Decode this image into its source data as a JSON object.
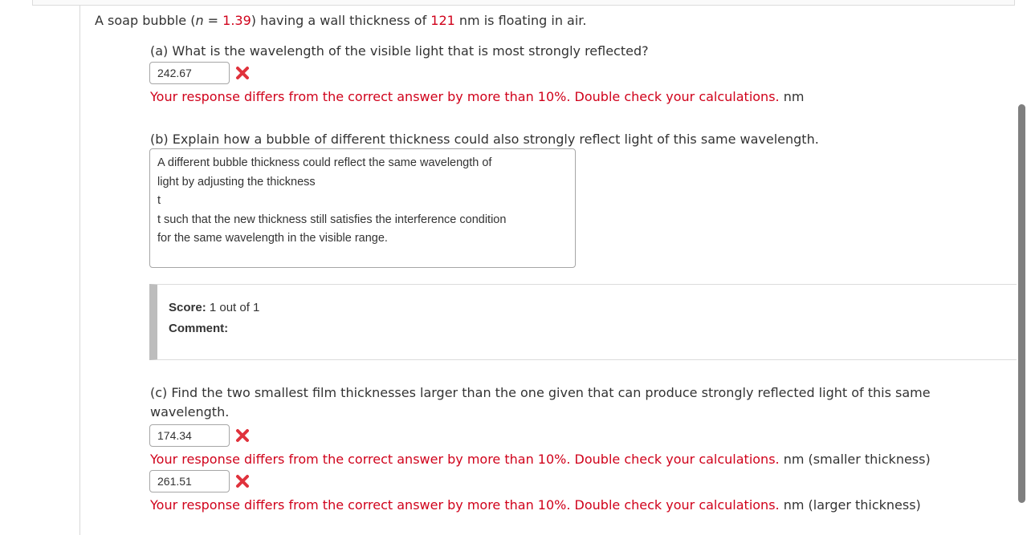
{
  "question": {
    "prefix": "A soap bubble (",
    "n_var": "n",
    "equals": " = ",
    "n_value": "1.39",
    "mid": ") having a wall thickness of ",
    "thickness": "121",
    "suffix": " nm is floating in air."
  },
  "part_a": {
    "prompt": "(a) What is the wavelength of the visible light that is most strongly reflected?",
    "answer": "242.67",
    "feedback": "Your response differs from the correct answer by more than 10%. Double check your calculations.",
    "unit": " nm"
  },
  "part_b": {
    "prompt": "(b) Explain how a bubble of different thickness could also strongly reflect light of this same wavelength.",
    "response_lines": [
      "A different bubble thickness could reflect the same wavelength of",
      "light by adjusting the thickness",
      "t",
      "t such that the new thickness still satisfies the interference condition",
      "for the same wavelength in the visible range."
    ]
  },
  "score": {
    "label": "Score:",
    "value": " 1 out of 1",
    "comment_label": "Comment:"
  },
  "part_c": {
    "prompt_line1": "(c) Find the two smallest film thicknesses larger than the one given that can produce strongly reflected light of this same",
    "prompt_line2": "wavelength.",
    "answer1": "174.34",
    "feedback1": "Your response differs from the correct answer by more than 10%. Double check your calculations.",
    "unit1": " nm (smaller thickness)",
    "answer2": "261.51",
    "feedback2": "Your response differs from the correct answer by more than 10%. Double check your calculations.",
    "unit2": " nm (larger thickness)"
  },
  "colors": {
    "error_red": "#d0021b",
    "x_icon": "#e0323c"
  },
  "icons": [
    "incorrect-x-icon"
  ]
}
